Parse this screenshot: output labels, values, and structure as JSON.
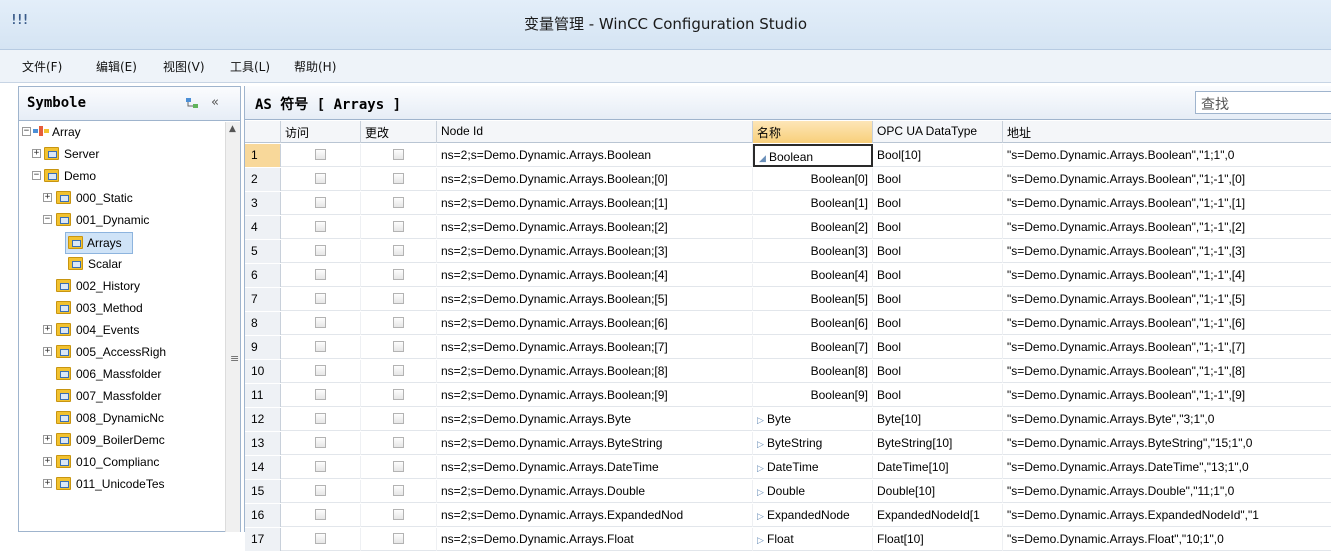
{
  "window": {
    "title": "变量管理 - WinCC Configuration Studio",
    "icon": "app-icon"
  },
  "menu": [
    "文件(F)",
    "编辑(E)",
    "视图(V)",
    "工具(L)",
    "帮助(H)"
  ],
  "left_panel": {
    "title": "Symbole",
    "collapse_label": "«",
    "tree": [
      {
        "label": "Array",
        "expander": "⊟",
        "icon": "array-icon"
      },
      {
        "label": "Server",
        "expander": "⊞",
        "icon": "folder-icon"
      },
      {
        "label": "Demo",
        "expander": "⊟",
        "icon": "folder-icon"
      },
      {
        "label": "000_Static",
        "expander": "⊞",
        "icon": "folder-icon"
      },
      {
        "label": "001_Dynamic",
        "expander": "⊟",
        "icon": "folder-icon"
      },
      {
        "label": "Arrays",
        "expander": "",
        "icon": "folder-icon",
        "selected": true
      },
      {
        "label": "Scalar",
        "expander": "",
        "icon": "folder-icon"
      },
      {
        "label": "002_History",
        "expander": "",
        "icon": "folder-icon"
      },
      {
        "label": "003_Method",
        "expander": "",
        "icon": "folder-icon"
      },
      {
        "label": "004_Events",
        "expander": "⊞",
        "icon": "folder-icon"
      },
      {
        "label": "005_AccessRigh",
        "expander": "⊞",
        "icon": "folder-icon"
      },
      {
        "label": "006_Massfolder",
        "expander": "",
        "icon": "folder-icon"
      },
      {
        "label": "007_Massfolder",
        "expander": "",
        "icon": "folder-icon"
      },
      {
        "label": "008_DynamicNc",
        "expander": "",
        "icon": "folder-icon"
      },
      {
        "label": "009_BoilerDemc",
        "expander": "⊞",
        "icon": "folder-icon"
      },
      {
        "label": "010_Complianc",
        "expander": "⊞",
        "icon": "folder-icon"
      },
      {
        "label": "011_UnicodeTes",
        "expander": "⊞",
        "icon": "folder-icon"
      }
    ]
  },
  "right_panel": {
    "title": "AS 符号 [ Arrays ]",
    "search_placeholder": "查找"
  },
  "grid": {
    "columns": [
      "",
      "访问",
      "更改",
      "Node Id",
      "名称",
      "OPC UA DataType",
      "地址"
    ],
    "rows": [
      {
        "num": "1",
        "node_id": "ns=2;s=Demo.Dynamic.Arrays.Boolean",
        "name": "Boolean",
        "expander": "◢",
        "type": "Bool[10]",
        "address": "\"s=Demo.Dynamic.Arrays.Boolean\",\"1;1\",0"
      },
      {
        "num": "2",
        "node_id": "ns=2;s=Demo.Dynamic.Arrays.Boolean;[0]",
        "name": "Boolean[0]",
        "expander": "",
        "type": "Bool",
        "address": "\"s=Demo.Dynamic.Arrays.Boolean\",\"1;-1\",[0]"
      },
      {
        "num": "3",
        "node_id": "ns=2;s=Demo.Dynamic.Arrays.Boolean;[1]",
        "name": "Boolean[1]",
        "expander": "",
        "type": "Bool",
        "address": "\"s=Demo.Dynamic.Arrays.Boolean\",\"1;-1\",[1]"
      },
      {
        "num": "4",
        "node_id": "ns=2;s=Demo.Dynamic.Arrays.Boolean;[2]",
        "name": "Boolean[2]",
        "expander": "",
        "type": "Bool",
        "address": "\"s=Demo.Dynamic.Arrays.Boolean\",\"1;-1\",[2]"
      },
      {
        "num": "5",
        "node_id": "ns=2;s=Demo.Dynamic.Arrays.Boolean;[3]",
        "name": "Boolean[3]",
        "expander": "",
        "type": "Bool",
        "address": "\"s=Demo.Dynamic.Arrays.Boolean\",\"1;-1\",[3]"
      },
      {
        "num": "6",
        "node_id": "ns=2;s=Demo.Dynamic.Arrays.Boolean;[4]",
        "name": "Boolean[4]",
        "expander": "",
        "type": "Bool",
        "address": "\"s=Demo.Dynamic.Arrays.Boolean\",\"1;-1\",[4]"
      },
      {
        "num": "7",
        "node_id": "ns=2;s=Demo.Dynamic.Arrays.Boolean;[5]",
        "name": "Boolean[5]",
        "expander": "",
        "type": "Bool",
        "address": "\"s=Demo.Dynamic.Arrays.Boolean\",\"1;-1\",[5]"
      },
      {
        "num": "8",
        "node_id": "ns=2;s=Demo.Dynamic.Arrays.Boolean;[6]",
        "name": "Boolean[6]",
        "expander": "",
        "type": "Bool",
        "address": "\"s=Demo.Dynamic.Arrays.Boolean\",\"1;-1\",[6]"
      },
      {
        "num": "9",
        "node_id": "ns=2;s=Demo.Dynamic.Arrays.Boolean;[7]",
        "name": "Boolean[7]",
        "expander": "",
        "type": "Bool",
        "address": "\"s=Demo.Dynamic.Arrays.Boolean\",\"1;-1\",[7]"
      },
      {
        "num": "10",
        "node_id": "ns=2;s=Demo.Dynamic.Arrays.Boolean;[8]",
        "name": "Boolean[8]",
        "expander": "",
        "type": "Bool",
        "address": "\"s=Demo.Dynamic.Arrays.Boolean\",\"1;-1\",[8]"
      },
      {
        "num": "11",
        "node_id": "ns=2;s=Demo.Dynamic.Arrays.Boolean;[9]",
        "name": "Boolean[9]",
        "expander": "",
        "type": "Bool",
        "address": "\"s=Demo.Dynamic.Arrays.Boolean\",\"1;-1\",[9]"
      },
      {
        "num": "12",
        "node_id": "ns=2;s=Demo.Dynamic.Arrays.Byte",
        "name": "Byte",
        "expander": "▷",
        "type": "Byte[10]",
        "address": "\"s=Demo.Dynamic.Arrays.Byte\",\"3;1\",0"
      },
      {
        "num": "13",
        "node_id": "ns=2;s=Demo.Dynamic.Arrays.ByteString",
        "name": "ByteString",
        "expander": "▷",
        "type": "ByteString[10]",
        "address": "\"s=Demo.Dynamic.Arrays.ByteString\",\"15;1\",0"
      },
      {
        "num": "14",
        "node_id": "ns=2;s=Demo.Dynamic.Arrays.DateTime",
        "name": "DateTime",
        "expander": "▷",
        "type": "DateTime[10]",
        "address": "\"s=Demo.Dynamic.Arrays.DateTime\",\"13;1\",0"
      },
      {
        "num": "15",
        "node_id": "ns=2;s=Demo.Dynamic.Arrays.Double",
        "name": "Double",
        "expander": "▷",
        "type": "Double[10]",
        "address": "\"s=Demo.Dynamic.Arrays.Double\",\"11;1\",0"
      },
      {
        "num": "16",
        "node_id": "ns=2;s=Demo.Dynamic.Arrays.ExpandedNod",
        "name": "ExpandedNode",
        "expander": "▷",
        "type": "ExpandedNodeId[1",
        "address": "\"s=Demo.Dynamic.Arrays.ExpandedNodeId\",\"1"
      },
      {
        "num": "17",
        "node_id": "ns=2;s=Demo.Dynamic.Arrays.Float",
        "name": "Float",
        "expander": "▷",
        "type": "Float[10]",
        "address": "\"s=Demo.Dynamic.Arrays.Float\",\"10;1\",0"
      }
    ]
  }
}
